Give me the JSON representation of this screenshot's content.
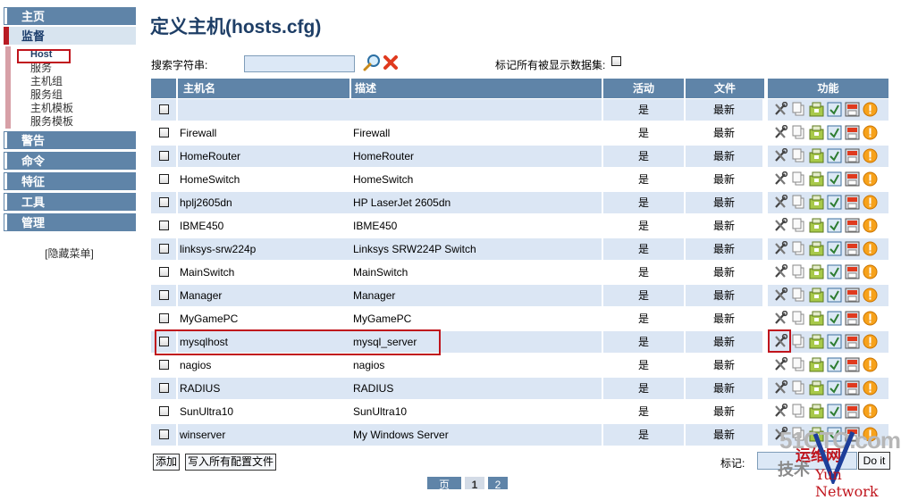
{
  "sidebar": {
    "menus": [
      {
        "label": "主页"
      },
      {
        "label": "监督"
      },
      {
        "label": "警告"
      },
      {
        "label": "命令"
      },
      {
        "label": "特征"
      },
      {
        "label": "工具"
      },
      {
        "label": "管理"
      }
    ],
    "submenu": [
      "Host",
      "服务",
      "主机组",
      "服务组",
      "主机模板",
      "服务模板"
    ],
    "hide_menu": "[隐藏菜单]"
  },
  "page_title": "定义主机(hosts.cfg)",
  "search": {
    "label": "搜索字符串:",
    "value": ""
  },
  "mark_all_label": "标记所有被显示数据集:",
  "table": {
    "headers": [
      "主机名",
      "描述",
      "活动",
      "文件",
      "功能"
    ],
    "rows": [
      {
        "name": "",
        "desc": "",
        "active": "是",
        "file": "最新"
      },
      {
        "name": "Firewall",
        "desc": "Firewall",
        "active": "是",
        "file": "最新"
      },
      {
        "name": "HomeRouter",
        "desc": "HomeRouter",
        "active": "是",
        "file": "最新"
      },
      {
        "name": "HomeSwitch",
        "desc": "HomeSwitch",
        "active": "是",
        "file": "最新"
      },
      {
        "name": "hplj2605dn",
        "desc": "HP LaserJet 2605dn",
        "active": "是",
        "file": "最新"
      },
      {
        "name": "IBME450",
        "desc": "IBME450",
        "active": "是",
        "file": "最新"
      },
      {
        "name": "linksys-srw224p",
        "desc": "Linksys SRW224P Switch",
        "active": "是",
        "file": "最新"
      },
      {
        "name": "MainSwitch",
        "desc": "MainSwitch",
        "active": "是",
        "file": "最新"
      },
      {
        "name": "Manager",
        "desc": "Manager",
        "active": "是",
        "file": "最新"
      },
      {
        "name": "MyGamePC",
        "desc": "MyGamePC",
        "active": "是",
        "file": "最新"
      },
      {
        "name": "mysqlhost",
        "desc": "mysql_server",
        "active": "是",
        "file": "最新"
      },
      {
        "name": "nagios",
        "desc": "nagios",
        "active": "是",
        "file": "最新"
      },
      {
        "name": "RADIUS",
        "desc": "RADIUS",
        "active": "是",
        "file": "最新"
      },
      {
        "name": "SunUltra10",
        "desc": "SunUltra10",
        "active": "是",
        "file": "最新"
      },
      {
        "name": "winserver",
        "desc": "My Windows Server",
        "active": "是",
        "file": "最新"
      }
    ],
    "function_icons": [
      "modify-icon",
      "copy-icon",
      "download-icon",
      "info-icon",
      "write-file-icon",
      "delete-icon"
    ]
  },
  "buttons": {
    "add": "添加",
    "write_all": "写入所有配置文件",
    "mark_label": "标记:",
    "mark_button": "Do it"
  },
  "pager": {
    "prev": "页",
    "page1": "1",
    "page2": "2"
  },
  "watermark": {
    "top": "51CTO.com",
    "mid": "运维网",
    "left": "技术",
    "right": "家",
    "bottom": "Yun Network"
  },
  "colors": {
    "header_blue": "#5f84a8",
    "row_alt": "#dbe6f4",
    "highlight_red": "#c0141c",
    "title": "#1e3e66"
  }
}
